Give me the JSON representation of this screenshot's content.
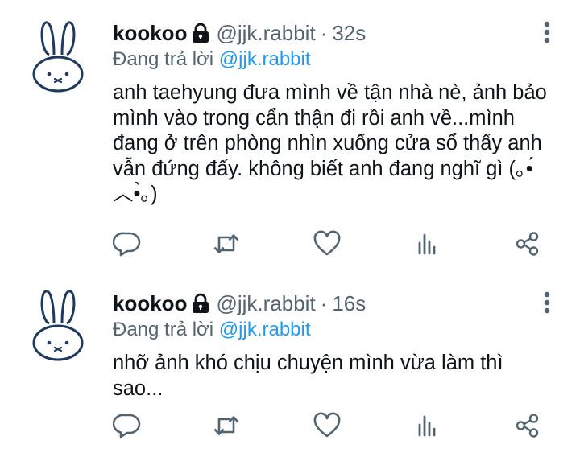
{
  "tweets": [
    {
      "display_name": "kookoo",
      "handle": "@jjk.rabbit",
      "separator": "·",
      "time": "32s",
      "reply_prefix": "Đang trả lời",
      "reply_to": "@jjk.rabbit",
      "text": "anh taehyung đưa mình về tận nhà nè, ảnh bảo mình vào trong cẩn thận đi rồi anh về...mình đang ở trên phòng nhìn xuống cửa sổ thấy anh vẫn đứng đấy. không biết anh đang nghĩ gì (｡•́︿•̀｡)"
    },
    {
      "display_name": "kookoo",
      "handle": "@jjk.rabbit",
      "separator": "·",
      "time": "16s",
      "reply_prefix": "Đang trả lời",
      "reply_to": "@jjk.rabbit",
      "text": "nhỡ ảnh khó chịu chuyện mình vừa làm thì sao..."
    }
  ],
  "icons": {
    "avatar": "rabbit-avatar",
    "lock": "lock-icon",
    "more": "more-vertical-icon",
    "actions": [
      "reply-icon",
      "retweet-icon",
      "like-icon",
      "analytics-icon",
      "share-icon"
    ]
  },
  "colors": {
    "accent": "#1d9bf0",
    "secondary_text": "#536471",
    "icon": "#536471",
    "divider": "#dfe3e6"
  }
}
